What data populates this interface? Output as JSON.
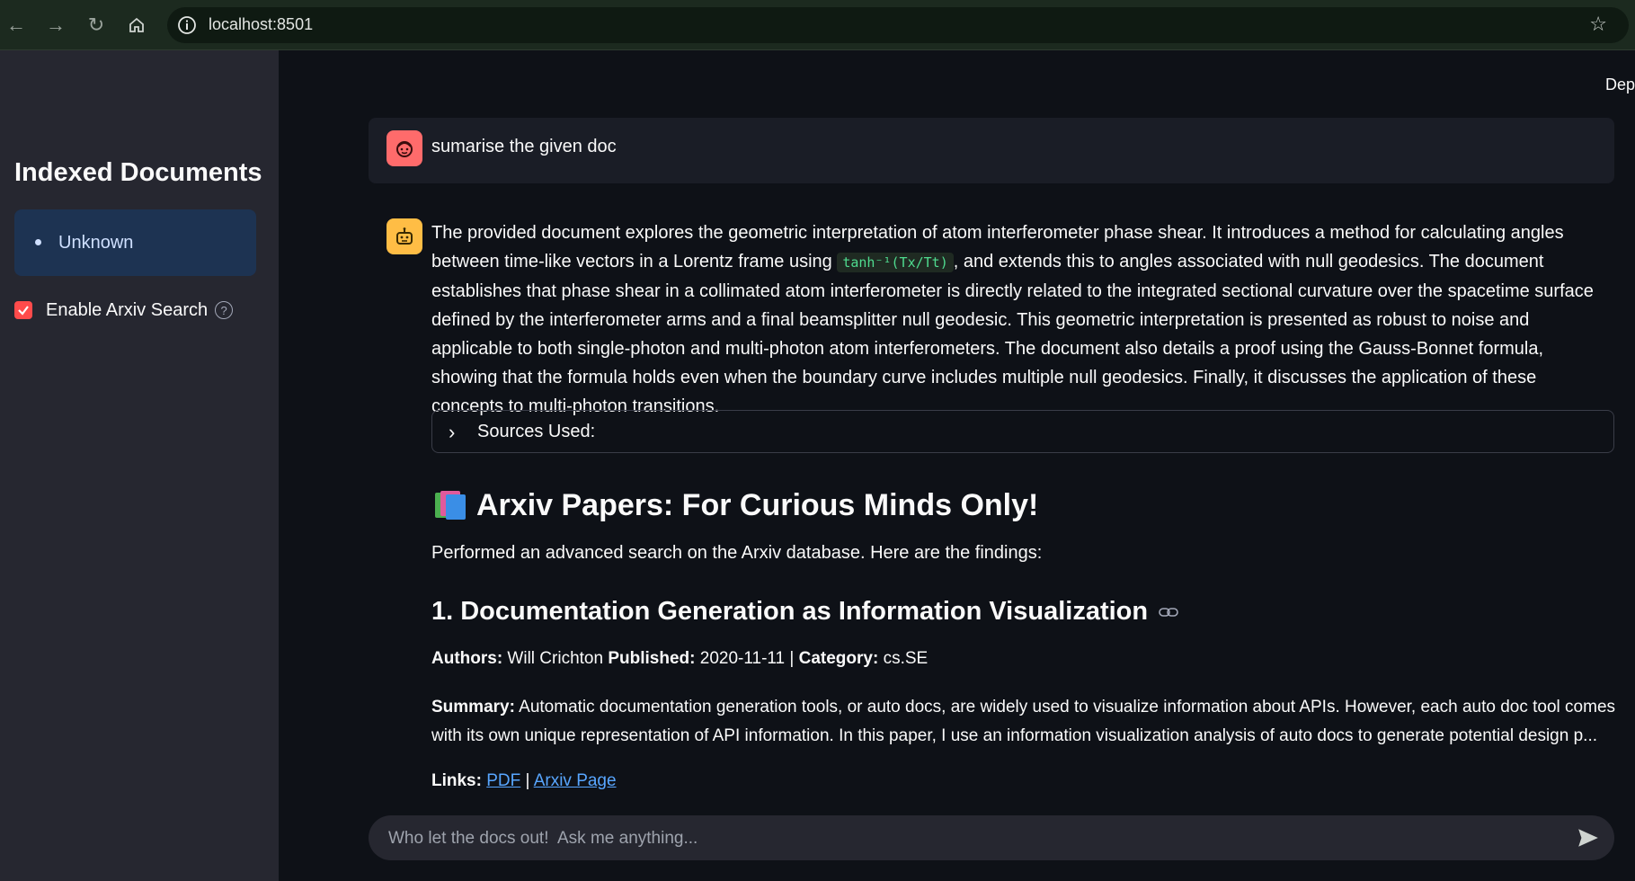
{
  "browser": {
    "url": "localhost:8501"
  },
  "sidebar": {
    "title": "Indexed Documents",
    "documents": [
      "Unknown"
    ],
    "arxiv_toggle": {
      "label": "Enable Arxiv Search",
      "checked": true
    }
  },
  "header": {
    "deploy_label": "Depl"
  },
  "chat": {
    "user_message": "sumarise the given doc",
    "bot_para_1": "The provided document explores the geometric interpretation of atom interferometer phase shear. It introduces a method for calculating angles between time-like vectors in a Lorentz frame using",
    "bot_code": "tanh⁻¹(Tx/Tt)",
    "bot_para_2": ", and extends this to angles associated with null geodesics. The document establishes that phase shear in a collimated atom interferometer is directly related to the integrated sectional curvature over the spacetime surface defined by the interferometer arms and a final beamsplitter null geodesic. This geometric interpretation is presented as robust to noise and applicable to both single-photon and multi-photon atom interferometers. The document also details a proof using the Gauss-Bonnet formula, showing that the formula holds even when the boundary curve includes multiple null geodesics. Finally, it discusses the application of these concepts to multi-photon transitions.",
    "sources_label": "Sources Used:",
    "arxiv_heading": "Arxiv Papers: For Curious Minds Only!",
    "findings_text": "Performed an advanced search on the Arxiv database. Here are the findings:",
    "paper": {
      "title": "1. Documentation Generation as Information Visualization",
      "authors_label": "Authors:",
      "authors": " Will Crichton ",
      "published_label": "Published:",
      "published": " 2020-11-11 | ",
      "category_label": "Category:",
      "category": " cs.SE",
      "summary_label": "Summary:",
      "summary": " Automatic documentation generation tools, or auto docs, are widely used to visualize information about APIs. However, each auto doc tool comes with its own unique representation of API information. In this paper, I use an information visualization analysis of auto docs to generate potential design p...",
      "links_label": "Links:",
      "pdf_label": "PDF",
      "separator": " | ",
      "page_label": "Arxiv Page"
    },
    "input_placeholder": "Who let the docs out!  Ask me anything..."
  },
  "icons": {
    "back": "arrow-left-icon",
    "forward": "arrow-right-icon",
    "reload": "reload-icon",
    "home": "home-icon",
    "info": "info-icon",
    "bookmark": "star-icon",
    "user_avatar": "user-face-icon",
    "bot_avatar": "robot-icon",
    "books": "books-icon",
    "link": "link-icon",
    "send": "send-icon",
    "help": "question-circle-icon"
  },
  "colors": {
    "accent": "#ff4b4b",
    "user_avatar_bg": "#ff6b6b",
    "bot_avatar_bg": "#ffbd45",
    "link": "#58a6ff",
    "code": "#4fdb8f",
    "sidebar_bg": "#262730",
    "main_bg": "#0e1117"
  }
}
